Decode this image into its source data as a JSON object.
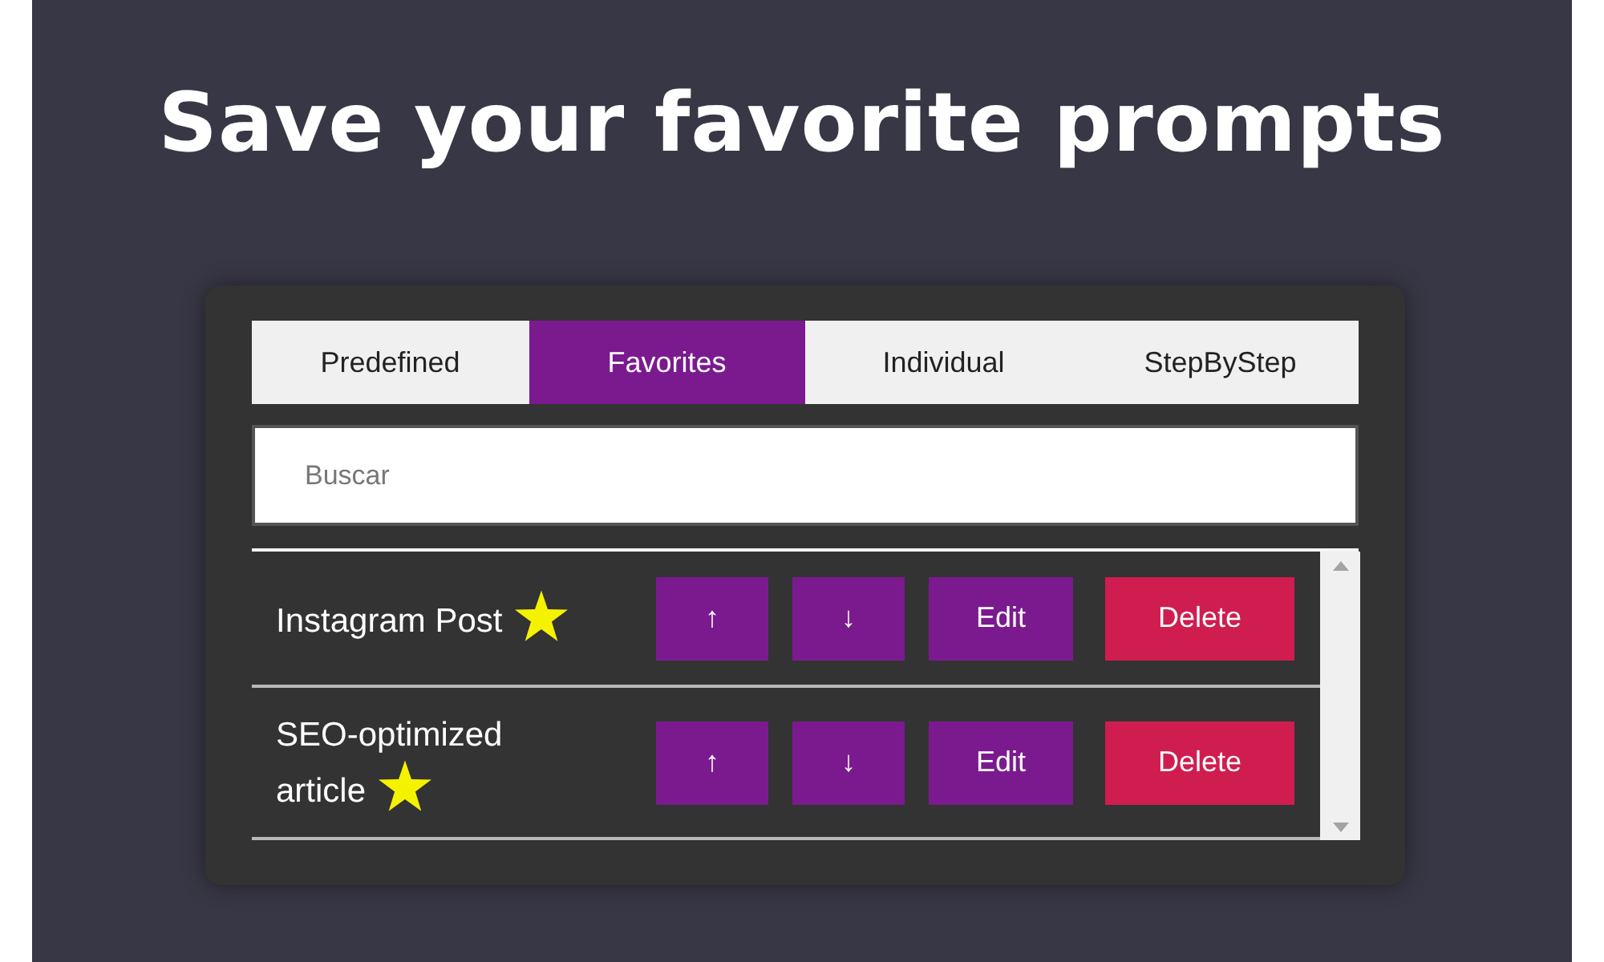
{
  "heading": "Save your favorite prompts",
  "tabs": [
    {
      "label": "Predefined",
      "selected": false
    },
    {
      "label": "Favorites",
      "selected": true
    },
    {
      "label": "Individual",
      "selected": false
    },
    {
      "label": "StepByStep",
      "selected": false
    }
  ],
  "search": {
    "placeholder": "Buscar"
  },
  "prompts": [
    {
      "name": "Instagram Post",
      "favorite": true,
      "buttons": [
        {
          "label": "↑",
          "kind": "move"
        },
        {
          "label": "↓",
          "kind": "move"
        },
        {
          "label": "Edit",
          "kind": "edit"
        },
        {
          "label": "Delete",
          "kind": "delete"
        }
      ]
    },
    {
      "name": "SEO-optimized article",
      "favorite": true,
      "buttons": [
        {
          "label": "↑",
          "kind": "move"
        },
        {
          "label": "↓",
          "kind": "move"
        },
        {
          "label": "Edit",
          "kind": "edit"
        },
        {
          "label": "Delete",
          "kind": "delete"
        }
      ]
    }
  ]
}
